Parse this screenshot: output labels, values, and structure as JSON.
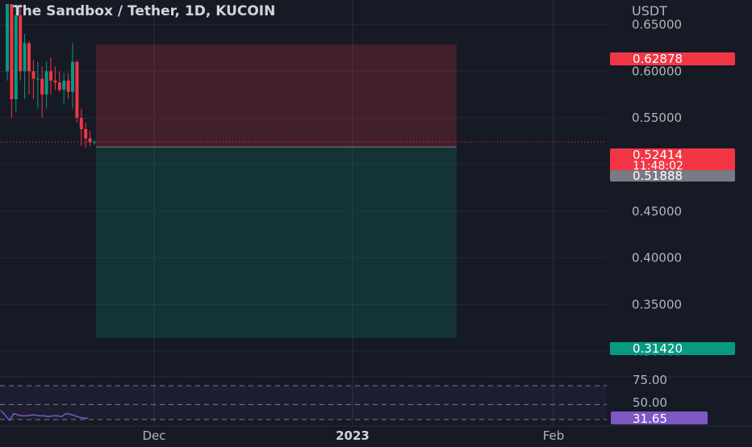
{
  "header": {
    "title": "The Sandbox / Tether, 1D, KUCOIN"
  },
  "price_axis": {
    "currency": "USDT",
    "ticks": [
      "0.65000",
      "0.60000",
      "0.55000",
      "0.45000",
      "0.40000",
      "0.35000",
      "0.30000"
    ],
    "ylim": [
      0.289,
      0.672
    ]
  },
  "badges": {
    "stop": {
      "value": "0.62878",
      "color": "#f23645"
    },
    "last": {
      "value": "0.52414",
      "countdown": "11:48:02",
      "color": "#f23645"
    },
    "entry": {
      "value": "0.51888",
      "color": "#787b86"
    },
    "target": {
      "value": "0.31420",
      "color": "#089981"
    }
  },
  "time_axis": {
    "labels": [
      "Dec",
      "2023",
      "Feb"
    ]
  },
  "rsi": {
    "levels": [
      "75.00",
      "50.00"
    ],
    "value": "31.65",
    "color": "#7e57c2",
    "values": [
      42,
      36,
      29,
      38,
      36,
      35,
      35,
      36,
      36,
      35,
      35,
      34,
      35,
      35,
      34,
      38,
      37,
      35,
      33,
      32,
      31.6
    ]
  },
  "chart_data": {
    "type": "candlestick",
    "title": "The Sandbox / Tether, 1D, KUCOIN",
    "ylabel": "USDT",
    "ylim": [
      0.289,
      0.672
    ],
    "up_color": "#089981",
    "down_color": "#f23645",
    "candles": [
      {
        "o": 0.6,
        "h": 0.672,
        "l": 0.59,
        "c": 0.672
      },
      {
        "o": 0.672,
        "h": 0.672,
        "l": 0.55,
        "c": 0.57
      },
      {
        "o": 0.57,
        "h": 0.672,
        "l": 0.556,
        "c": 0.66
      },
      {
        "o": 0.66,
        "h": 0.672,
        "l": 0.59,
        "c": 0.6
      },
      {
        "o": 0.6,
        "h": 0.64,
        "l": 0.57,
        "c": 0.63
      },
      {
        "o": 0.63,
        "h": 0.632,
        "l": 0.575,
        "c": 0.6
      },
      {
        "o": 0.6,
        "h": 0.612,
        "l": 0.57,
        "c": 0.592
      },
      {
        "o": 0.592,
        "h": 0.61,
        "l": 0.56,
        "c": 0.592
      },
      {
        "o": 0.592,
        "h": 0.605,
        "l": 0.55,
        "c": 0.575
      },
      {
        "o": 0.575,
        "h": 0.61,
        "l": 0.56,
        "c": 0.6
      },
      {
        "o": 0.6,
        "h": 0.615,
        "l": 0.575,
        "c": 0.59
      },
      {
        "o": 0.59,
        "h": 0.605,
        "l": 0.58,
        "c": 0.588
      },
      {
        "o": 0.588,
        "h": 0.6,
        "l": 0.578,
        "c": 0.58
      },
      {
        "o": 0.58,
        "h": 0.598,
        "l": 0.565,
        "c": 0.59
      },
      {
        "o": 0.59,
        "h": 0.598,
        "l": 0.57,
        "c": 0.578
      },
      {
        "o": 0.578,
        "h": 0.63,
        "l": 0.56,
        "c": 0.61
      },
      {
        "o": 0.61,
        "h": 0.612,
        "l": 0.545,
        "c": 0.55
      },
      {
        "o": 0.55,
        "h": 0.56,
        "l": 0.52,
        "c": 0.538
      },
      {
        "o": 0.538,
        "h": 0.545,
        "l": 0.518,
        "c": 0.528
      },
      {
        "o": 0.528,
        "h": 0.536,
        "l": 0.52,
        "c": 0.524
      },
      {
        "o": 0.524,
        "h": 0.526,
        "l": 0.521,
        "c": 0.524
      }
    ],
    "position": {
      "stop": 0.62878,
      "entry": 0.51888,
      "target": 0.3142
    },
    "last_price": 0.52414
  }
}
